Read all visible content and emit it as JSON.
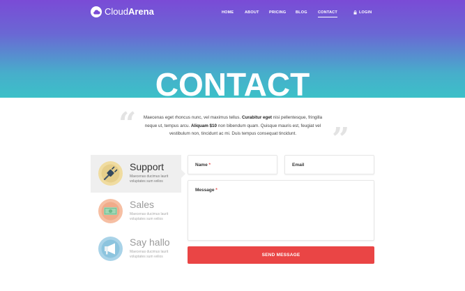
{
  "brand": {
    "name_light": "Cloud",
    "name_bold": "Arena"
  },
  "nav": {
    "items": [
      {
        "label": "HOME"
      },
      {
        "label": "ABOUT"
      },
      {
        "label": "PRICING"
      },
      {
        "label": "BLOG"
      },
      {
        "label": "CONTACT",
        "active": true
      }
    ],
    "login_label": "LOGIN"
  },
  "hero": {
    "title": "CONTACT"
  },
  "quote": {
    "open_mark": "“",
    "close_mark": "”",
    "part1": "Maecenas eget rhoncus nunc, vel maximus tellus. ",
    "bold1": "Curabitur eget",
    "part2": " nisi pellentesque, fringilla neque ut, tempus arcu. ",
    "bold2": "Aliquam $10",
    "part3": " non bibendum quam. Quisque mauris est, feugiat vel vestibulum non, tincidunt ac mi. Duis tempus consequat tincidunt."
  },
  "contact_options": [
    {
      "title": "Support",
      "description": "Maecenas ducimus laurit voluptates sum velios",
      "icon": "plug-icon",
      "color": "#f0dca0",
      "active": true
    },
    {
      "title": "Sales",
      "description": "Maecenas ducimus laurit voluptates sum velios",
      "icon": "money-icon",
      "color": "#f6bfa3",
      "active": false
    },
    {
      "title": "Say hallo",
      "description": "Maecenas ducimus laurit voluptates sum velios",
      "icon": "megaphone-icon",
      "color": "#a9d3e8",
      "active": false
    }
  ],
  "form": {
    "name_label": "Name",
    "email_label": "Email",
    "message_label": "Message",
    "required_mark": "*",
    "submit_label": "SEND MESSAGE"
  },
  "colors": {
    "accent": "#ea4545",
    "gradient_top": "#7a4bd6",
    "gradient_bottom": "#3cc0c8"
  }
}
